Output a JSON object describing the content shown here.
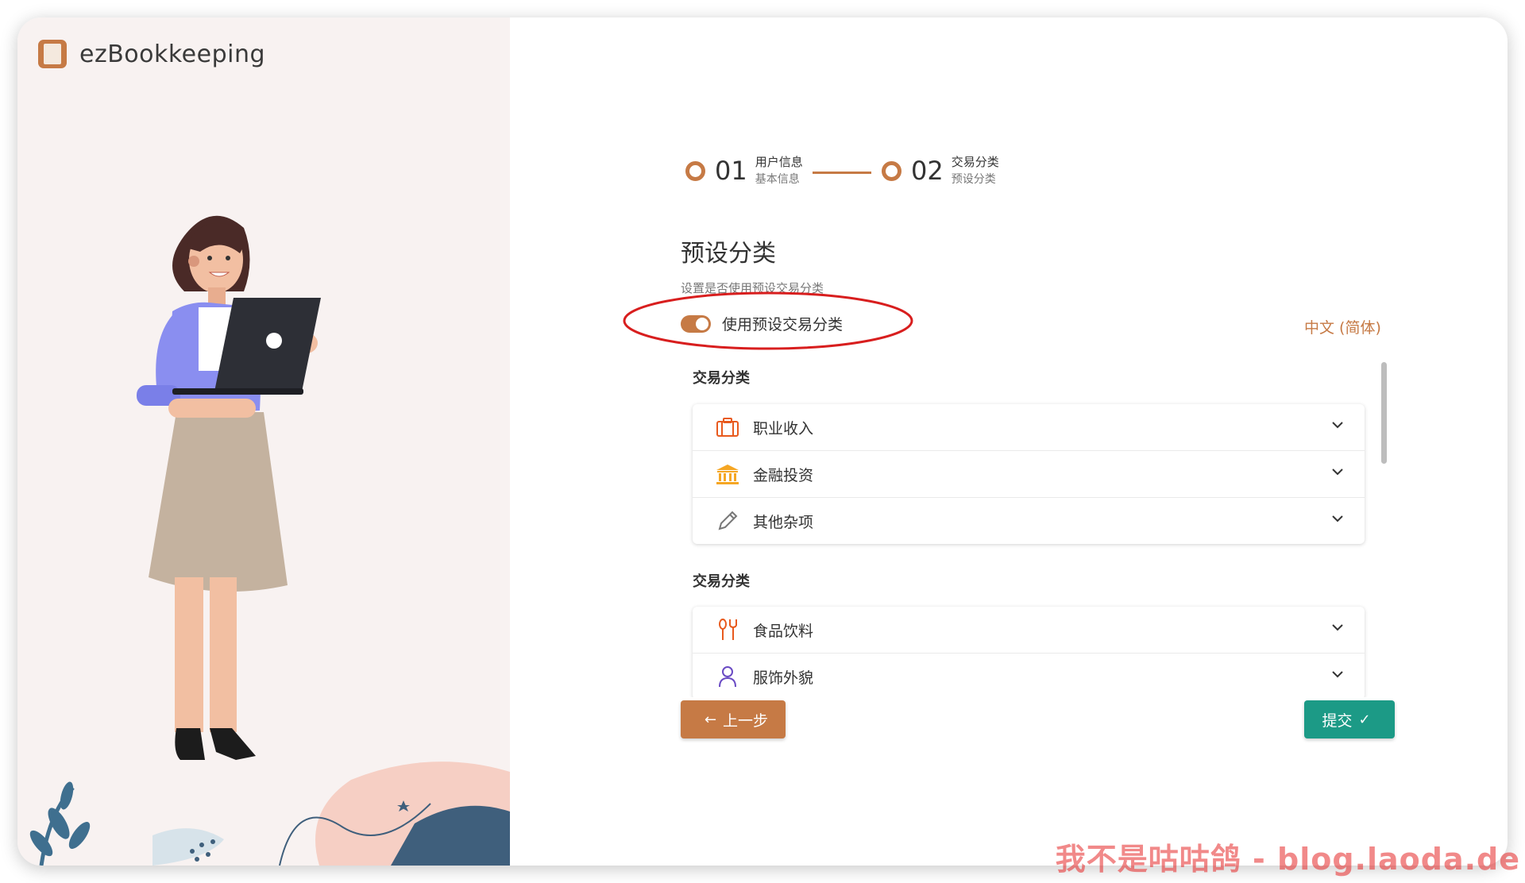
{
  "app": {
    "name": "ezBookkeeping"
  },
  "stepper": {
    "steps": [
      {
        "number": "01",
        "title": "用户信息",
        "subtitle": "基本信息"
      },
      {
        "number": "02",
        "title": "交易分类",
        "subtitle": "预设分类"
      }
    ]
  },
  "section": {
    "title": "预设分类",
    "description": "设置是否使用预设交易分类"
  },
  "toggle": {
    "label": "使用预设交易分类",
    "checked": true
  },
  "language": "中文 (简体)",
  "category_groups": [
    {
      "title": "交易分类",
      "items": [
        {
          "name": "职业收入",
          "icon": "briefcase-icon",
          "color": "#e85a1e"
        },
        {
          "name": "金融投资",
          "icon": "bank-icon",
          "color": "#f5a623"
        },
        {
          "name": "其他杂项",
          "icon": "pencil-icon",
          "color": "#777777"
        }
      ]
    },
    {
      "title": "交易分类",
      "items": [
        {
          "name": "食品饮料",
          "icon": "utensils-icon",
          "color": "#e85a1e"
        },
        {
          "name": "服饰外貌",
          "icon": "person-icon",
          "color": "#6a4bc4"
        }
      ]
    }
  ],
  "buttons": {
    "prev": "上一步",
    "submit": "提交"
  },
  "colors": {
    "accent": "#c67a45",
    "submit": "#1c9a86",
    "annotation": "#d81e1e"
  },
  "watermark": "我不是咕咕鸽 - blog.laoda.de"
}
